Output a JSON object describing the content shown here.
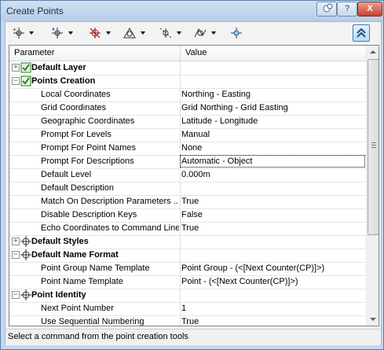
{
  "window": {
    "title": "Create Points"
  },
  "titlebar_buttons": {
    "help": "?",
    "close": "X"
  },
  "grid": {
    "col_parameter": "Parameter",
    "col_value": "Value",
    "rows": [
      {
        "param": "Default Layer",
        "value": "",
        "category": true,
        "expanded": false,
        "icon": "layer-icon"
      },
      {
        "param": "Points Creation",
        "value": "",
        "category": true,
        "expanded": true,
        "icon": "layer-icon"
      },
      {
        "param": "Local Coordinates",
        "value": "Northing - Easting"
      },
      {
        "param": "Grid Coordinates",
        "value": "Grid Northing - Grid Easting"
      },
      {
        "param": "Geographic Coordinates",
        "value": "Latitude - Longitude"
      },
      {
        "param": "Prompt For Levels",
        "value": "Manual"
      },
      {
        "param": "Prompt For Point Names",
        "value": "None"
      },
      {
        "param": "Prompt For Descriptions",
        "value": "Automatic - Object",
        "selected": true
      },
      {
        "param": "Default Level",
        "value": "0.000m"
      },
      {
        "param": "Default Description",
        "value": ""
      },
      {
        "param": "Match On Description Parameters ...",
        "value": "True"
      },
      {
        "param": "Disable Description Keys",
        "value": "False"
      },
      {
        "param": "Echo Coordinates to Command Line",
        "value": "True"
      },
      {
        "param": "Default Styles",
        "value": "",
        "category": true,
        "expanded": false,
        "icon": "style-icon"
      },
      {
        "param": "Default Name Format",
        "value": "",
        "category": true,
        "expanded": true,
        "icon": "style-icon"
      },
      {
        "param": "Point Group Name Template",
        "value": "Point Group - (<[Next Counter(CP)]>)"
      },
      {
        "param": "Point Name Template",
        "value": "Point - (<[Next Counter(CP)]>)"
      },
      {
        "param": "Point Identity",
        "value": "",
        "category": true,
        "expanded": true,
        "icon": "style-icon"
      },
      {
        "param": "Next Point Number",
        "value": "1"
      },
      {
        "param": "Use Sequential Numbering",
        "value": "True"
      }
    ]
  },
  "status": {
    "text": "Select a command from the point creation tools"
  },
  "colors": {
    "titlebar": "#c4d7ec",
    "accent": "#3c7fb1"
  }
}
